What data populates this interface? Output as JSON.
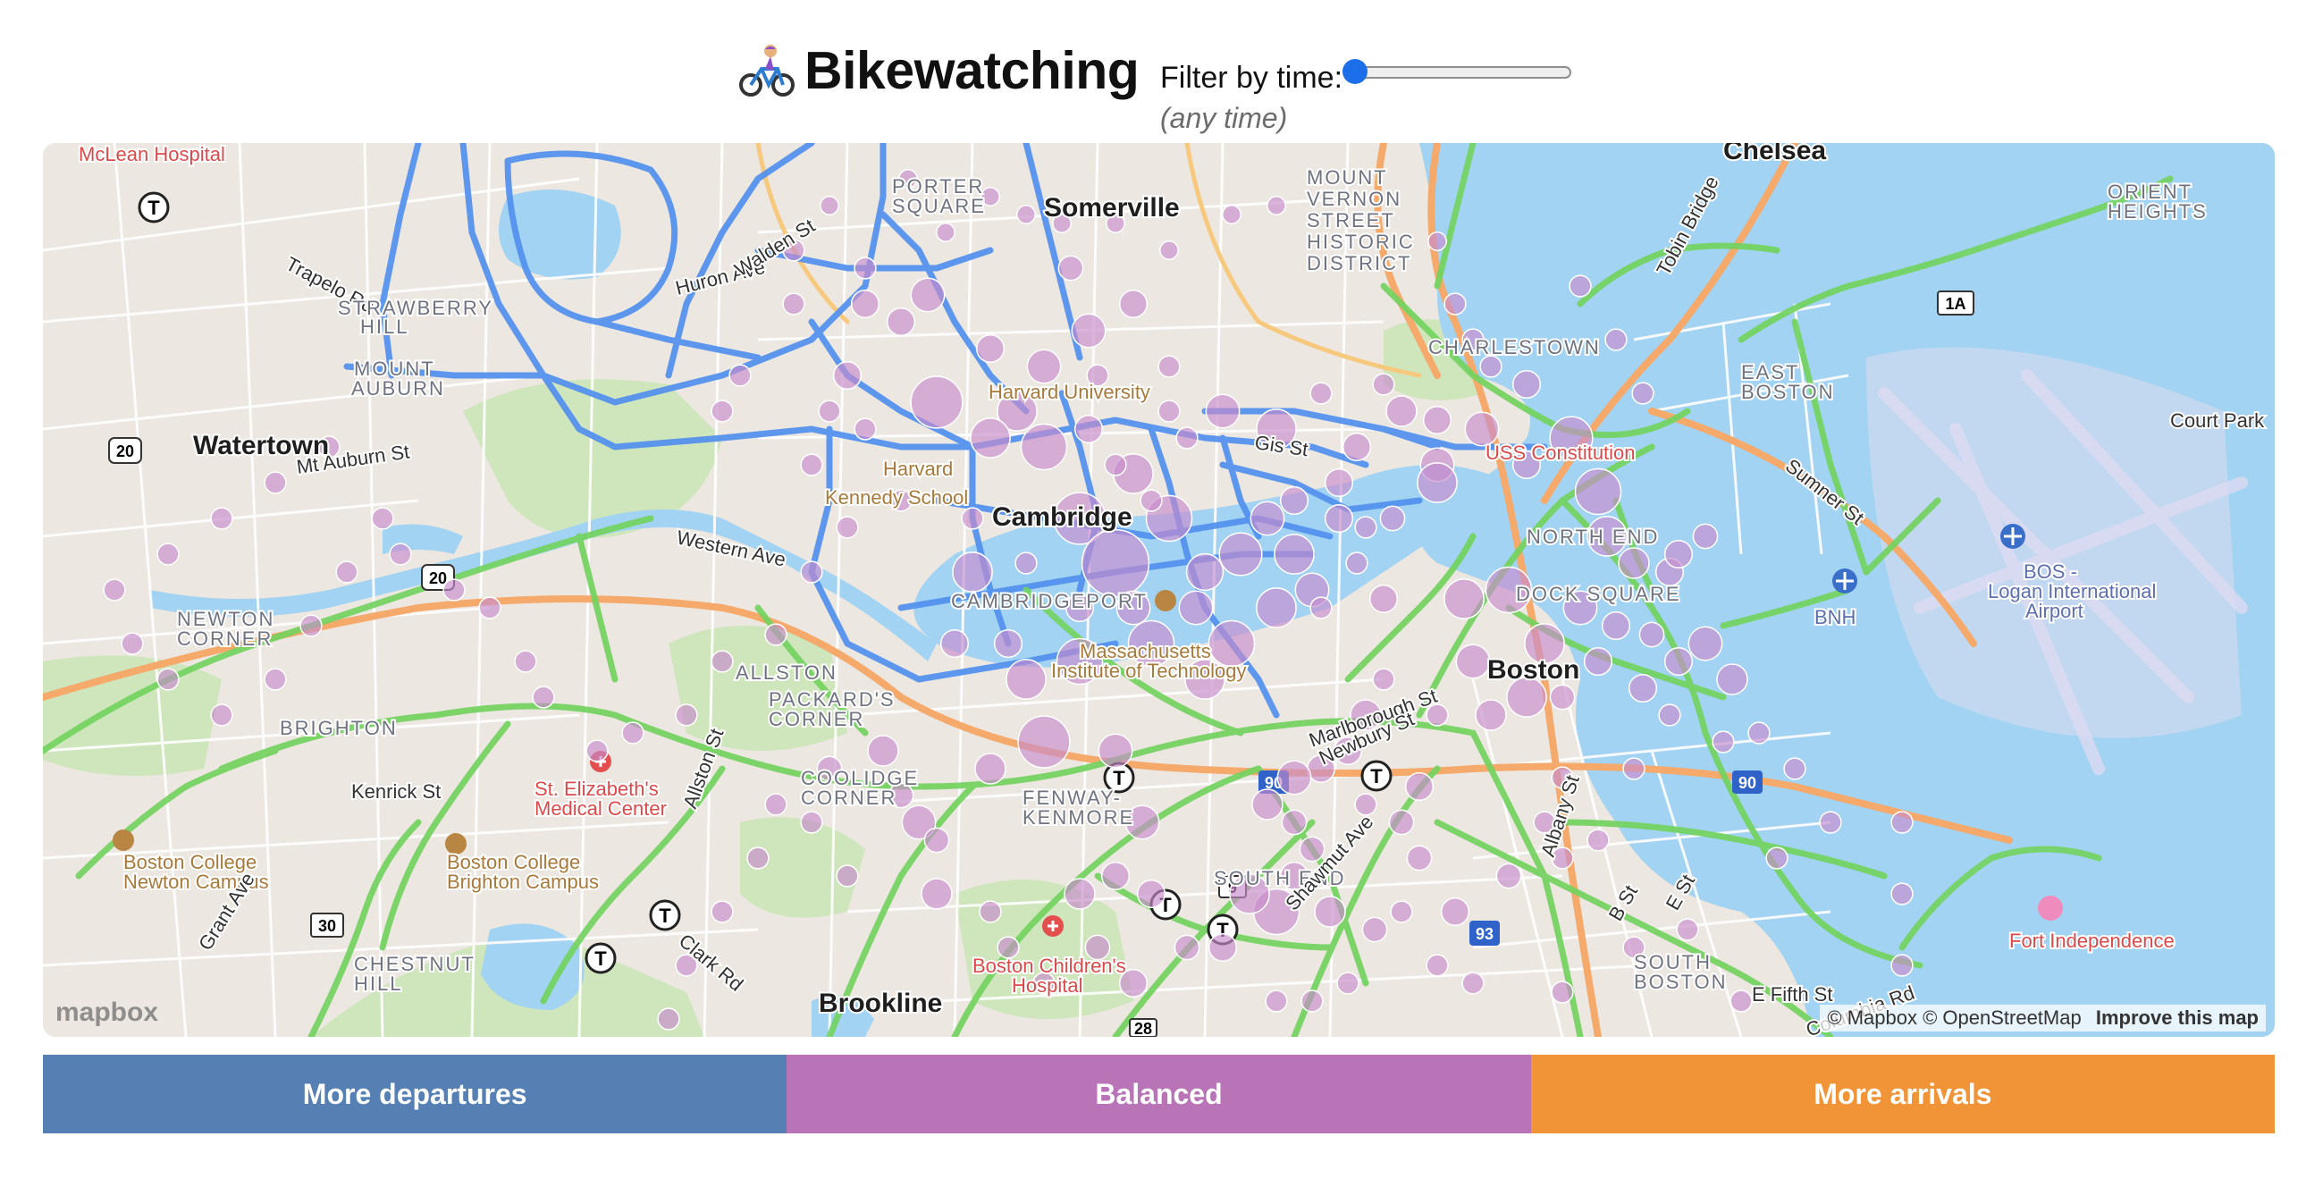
{
  "header": {
    "title": "Bikewatching",
    "icon": "person-biking-icon",
    "filter_label": "Filter by time:",
    "slider_value_fraction": 0,
    "time_readout": "(any time)"
  },
  "map": {
    "places": [
      {
        "text": "McLean Hospital",
        "kind": "poi"
      },
      {
        "text": "Trapelo Rd",
        "kind": "road"
      },
      {
        "text": "STRAWBERRY",
        "kind": "hood"
      },
      {
        "text": "HILL",
        "kind": "hood"
      },
      {
        "text": "MOUNT",
        "kind": "hood"
      },
      {
        "text": "AUBURN",
        "kind": "hood"
      },
      {
        "text": "Watertown",
        "kind": "city"
      },
      {
        "text": "Mt Auburn St",
        "kind": "road"
      },
      {
        "text": "NEWTON",
        "kind": "hood"
      },
      {
        "text": "CORNER",
        "kind": "hood"
      },
      {
        "text": "BRIGHTON",
        "kind": "hood"
      },
      {
        "text": "Kenrick St",
        "kind": "road"
      },
      {
        "text": "St. Elizabeth's",
        "kind": "hospital"
      },
      {
        "text": "Medical Center",
        "kind": "hospital"
      },
      {
        "text": "Boston College",
        "kind": "college"
      },
      {
        "text": "Newton Campus",
        "kind": "college"
      },
      {
        "text": "Boston College",
        "kind": "college"
      },
      {
        "text": "Brighton Campus",
        "kind": "college"
      },
      {
        "text": "CHESTNUT",
        "kind": "hood"
      },
      {
        "text": "HILL",
        "kind": "hood"
      },
      {
        "text": "Grant Ave",
        "kind": "road"
      },
      {
        "text": "Clark Rd",
        "kind": "road"
      },
      {
        "text": "Brookline",
        "kind": "city"
      },
      {
        "text": "ALLSTON",
        "kind": "hood"
      },
      {
        "text": "Allston St",
        "kind": "road"
      },
      {
        "text": "PACKARD'S",
        "kind": "hood"
      },
      {
        "text": "CORNER",
        "kind": "hood"
      },
      {
        "text": "COOLIDGE",
        "kind": "hood"
      },
      {
        "text": "CORNER",
        "kind": "hood"
      },
      {
        "text": "Western Ave",
        "kind": "road"
      },
      {
        "text": "Harvard",
        "kind": "college"
      },
      {
        "text": "Kennedy School",
        "kind": "college"
      },
      {
        "text": "Harvard University",
        "kind": "college"
      },
      {
        "text": "PORTER",
        "kind": "hood"
      },
      {
        "text": "SQUARE",
        "kind": "hood"
      },
      {
        "text": "Huron Ave",
        "kind": "road"
      },
      {
        "text": "Walden St",
        "kind": "road"
      },
      {
        "text": "Somerville",
        "kind": "city"
      },
      {
        "text": "MOUNT",
        "kind": "hood"
      },
      {
        "text": "VERNON",
        "kind": "hood"
      },
      {
        "text": "STREET",
        "kind": "hood"
      },
      {
        "text": "HISTORIC",
        "kind": "hood"
      },
      {
        "text": "DISTRICT",
        "kind": "hood"
      },
      {
        "text": "Cambridge",
        "kind": "city"
      },
      {
        "text": "CAMBRIDGEPORT",
        "kind": "hood"
      },
      {
        "text": "Massachusetts",
        "kind": "college"
      },
      {
        "text": "Institute of Technology",
        "kind": "college"
      },
      {
        "text": "Gis St",
        "kind": "road"
      },
      {
        "text": "CHARLESTOWN",
        "kind": "hood"
      },
      {
        "text": "USS Constitution",
        "kind": "poi"
      },
      {
        "text": "Chelsea",
        "kind": "city"
      },
      {
        "text": "Tobin Bridge",
        "kind": "road"
      },
      {
        "text": "EAST",
        "kind": "hood"
      },
      {
        "text": "BOSTON",
        "kind": "hood"
      },
      {
        "text": "ORIENT",
        "kind": "hood"
      },
      {
        "text": "HEIGHTS",
        "kind": "hood"
      },
      {
        "text": "Court Park",
        "kind": "road"
      },
      {
        "text": "Sumner St",
        "kind": "road"
      },
      {
        "text": "BOS -",
        "kind": "airport"
      },
      {
        "text": "Logan International",
        "kind": "airport"
      },
      {
        "text": "Airport",
        "kind": "airport"
      },
      {
        "text": "BNH",
        "kind": "airport"
      },
      {
        "text": "NORTH END",
        "kind": "hood"
      },
      {
        "text": "DOCK SQUARE",
        "kind": "hood"
      },
      {
        "text": "Boston",
        "kind": "city"
      },
      {
        "text": "Marlborough St",
        "kind": "road"
      },
      {
        "text": "Newbury St",
        "kind": "road"
      },
      {
        "text": "FENWAY-",
        "kind": "hood"
      },
      {
        "text": "KENMORE",
        "kind": "hood"
      },
      {
        "text": "SOUTH END",
        "kind": "hood"
      },
      {
        "text": "Shawmut Ave",
        "kind": "road"
      },
      {
        "text": "Albany St",
        "kind": "road"
      },
      {
        "text": "Boston Children's",
        "kind": "hospital"
      },
      {
        "text": "Hospital",
        "kind": "hospital"
      },
      {
        "text": "B St",
        "kind": "road"
      },
      {
        "text": "E St",
        "kind": "road"
      },
      {
        "text": "SOUTH",
        "kind": "hood"
      },
      {
        "text": "BOSTON",
        "kind": "hood"
      },
      {
        "text": "E Fifth St",
        "kind": "road"
      },
      {
        "text": "Columbia Rd",
        "kind": "road"
      },
      {
        "text": "Fort Independence",
        "kind": "poi"
      }
    ],
    "shields": [
      "20",
      "20",
      "30",
      "1A",
      "90",
      "90",
      "93",
      "9",
      "28"
    ],
    "attribution": "© Mapbox © OpenStreetMap",
    "improve_link": "Improve this map",
    "logo": "mapbox"
  },
  "legend": {
    "items": [
      {
        "label": "More departures",
        "color": "#5680b4"
      },
      {
        "label": "Balanced",
        "color": "#b974b7"
      },
      {
        "label": "More arrivals",
        "color": "#f09437"
      }
    ]
  },
  "colors": {
    "station_fill": "#c88ccc",
    "station_stroke": "#ffffff",
    "bike_lane_boston": "#6ed25a",
    "bike_lane_cambridge": "#4f8ef0",
    "water": "#a3d3f2",
    "park": "#cde8b8",
    "highway": "#f5a96b",
    "slider_thumb": "#1d6fe9"
  }
}
